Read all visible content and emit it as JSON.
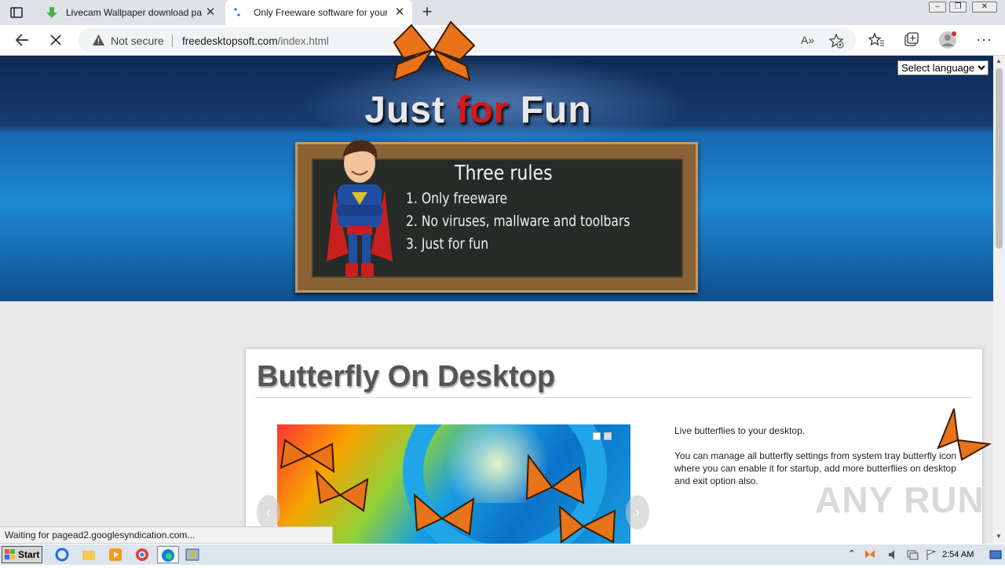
{
  "browser": {
    "tabs": [
      {
        "label": "Livecam Wallpaper download pa",
        "active": false
      },
      {
        "label": "Only Freeware software for your",
        "active": true
      }
    ],
    "address": {
      "security_label": "Not secure",
      "url_host": "freedesktopsoft.com",
      "url_path": "/index.html"
    },
    "status_text": "Waiting for pagead2.googlesyndication.com..."
  },
  "page": {
    "language_select": {
      "selected": "Select language"
    },
    "site_title": {
      "part1": "Just ",
      "part2": "for",
      "part3": " Fun"
    },
    "rules": {
      "title": "Three rules",
      "items": [
        "1. Only freeware",
        "2. No viruses, mallware and toolbars",
        "3. Just for fun"
      ]
    },
    "product": {
      "title": "Butterfly On Desktop",
      "description": [
        "Live butterflies to your desktop.",
        "You can manage all butterfly settings from system tray butterfly icon where you can enable it for startup, add more butterflies on desktop and exit option also."
      ]
    },
    "watermark": "ANY RUN"
  },
  "taskbar": {
    "start_label": "Start",
    "clock": "2:54 AM"
  },
  "colors": {
    "title_red": "#d8161b",
    "banner_blue": "#1d8ad6",
    "banner_dark": "#0d2a54"
  }
}
